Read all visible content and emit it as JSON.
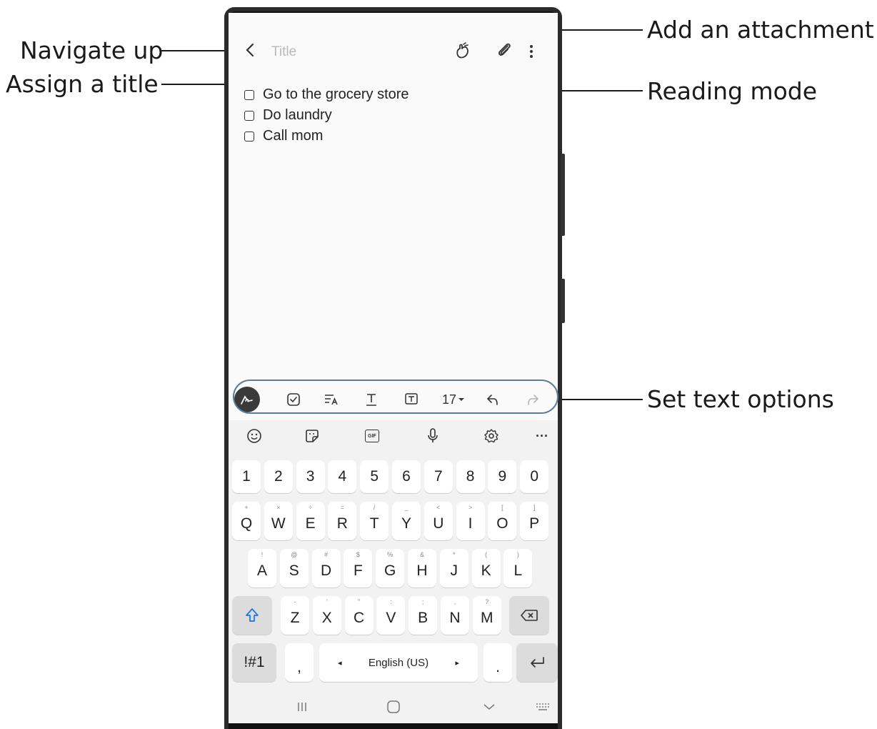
{
  "callouts": {
    "navigate_up": "Navigate up",
    "assign_title": "Assign a title",
    "add_attachment": "Add an attachment",
    "reading_mode": "Reading mode",
    "text_options": "Set text options"
  },
  "note": {
    "title_placeholder": "Title",
    "items": [
      "Go to the grocery store",
      "Do laundry",
      "Call mom"
    ]
  },
  "toolbar": {
    "font_size": "17",
    "icons": [
      "pen-icon",
      "checkbox-icon",
      "text-style-icon",
      "text-underline-icon",
      "text-box-icon",
      "font-size-dropdown",
      "undo-icon",
      "redo-icon"
    ]
  },
  "keyboard": {
    "top_icons": [
      "emoji-icon",
      "sticker-icon",
      "gif-icon",
      "mic-icon",
      "settings-icon",
      "more-icon"
    ],
    "gif_label": "GIF",
    "more_label": "···",
    "numbers": [
      "1",
      "2",
      "3",
      "4",
      "5",
      "6",
      "7",
      "8",
      "9",
      "0"
    ],
    "row1": [
      {
        "k": "Q",
        "h": "+"
      },
      {
        "k": "W",
        "h": "×"
      },
      {
        "k": "E",
        "h": "÷"
      },
      {
        "k": "R",
        "h": "="
      },
      {
        "k": "T",
        "h": "/"
      },
      {
        "k": "Y",
        "h": "_"
      },
      {
        "k": "U",
        "h": "<"
      },
      {
        "k": "I",
        "h": ">"
      },
      {
        "k": "O",
        "h": "["
      },
      {
        "k": "P",
        "h": "]"
      }
    ],
    "row2": [
      {
        "k": "A",
        "h": "!"
      },
      {
        "k": "S",
        "h": "@"
      },
      {
        "k": "D",
        "h": "#"
      },
      {
        "k": "F",
        "h": "$"
      },
      {
        "k": "G",
        "h": "%"
      },
      {
        "k": "H",
        "h": "&"
      },
      {
        "k": "J",
        "h": "*"
      },
      {
        "k": "K",
        "h": "("
      },
      {
        "k": "L",
        "h": ")"
      }
    ],
    "row3": [
      {
        "k": "Z",
        "h": "-"
      },
      {
        "k": "X",
        "h": "'"
      },
      {
        "k": "C",
        "h": "\""
      },
      {
        "k": "V",
        "h": ":"
      },
      {
        "k": "B",
        "h": ";"
      },
      {
        "k": "N",
        "h": ","
      },
      {
        "k": "M",
        "h": "?"
      }
    ],
    "symbols_key": "!#1",
    "comma_key": ",",
    "space_label": "English (US)",
    "period_key": ".",
    "left_arrow": "◂",
    "right_arrow": "▸"
  },
  "colors": {
    "accent_outline": "#5b7f9a",
    "callout_line": "#1a1a1a",
    "shift_icon": "#1a73e8"
  }
}
